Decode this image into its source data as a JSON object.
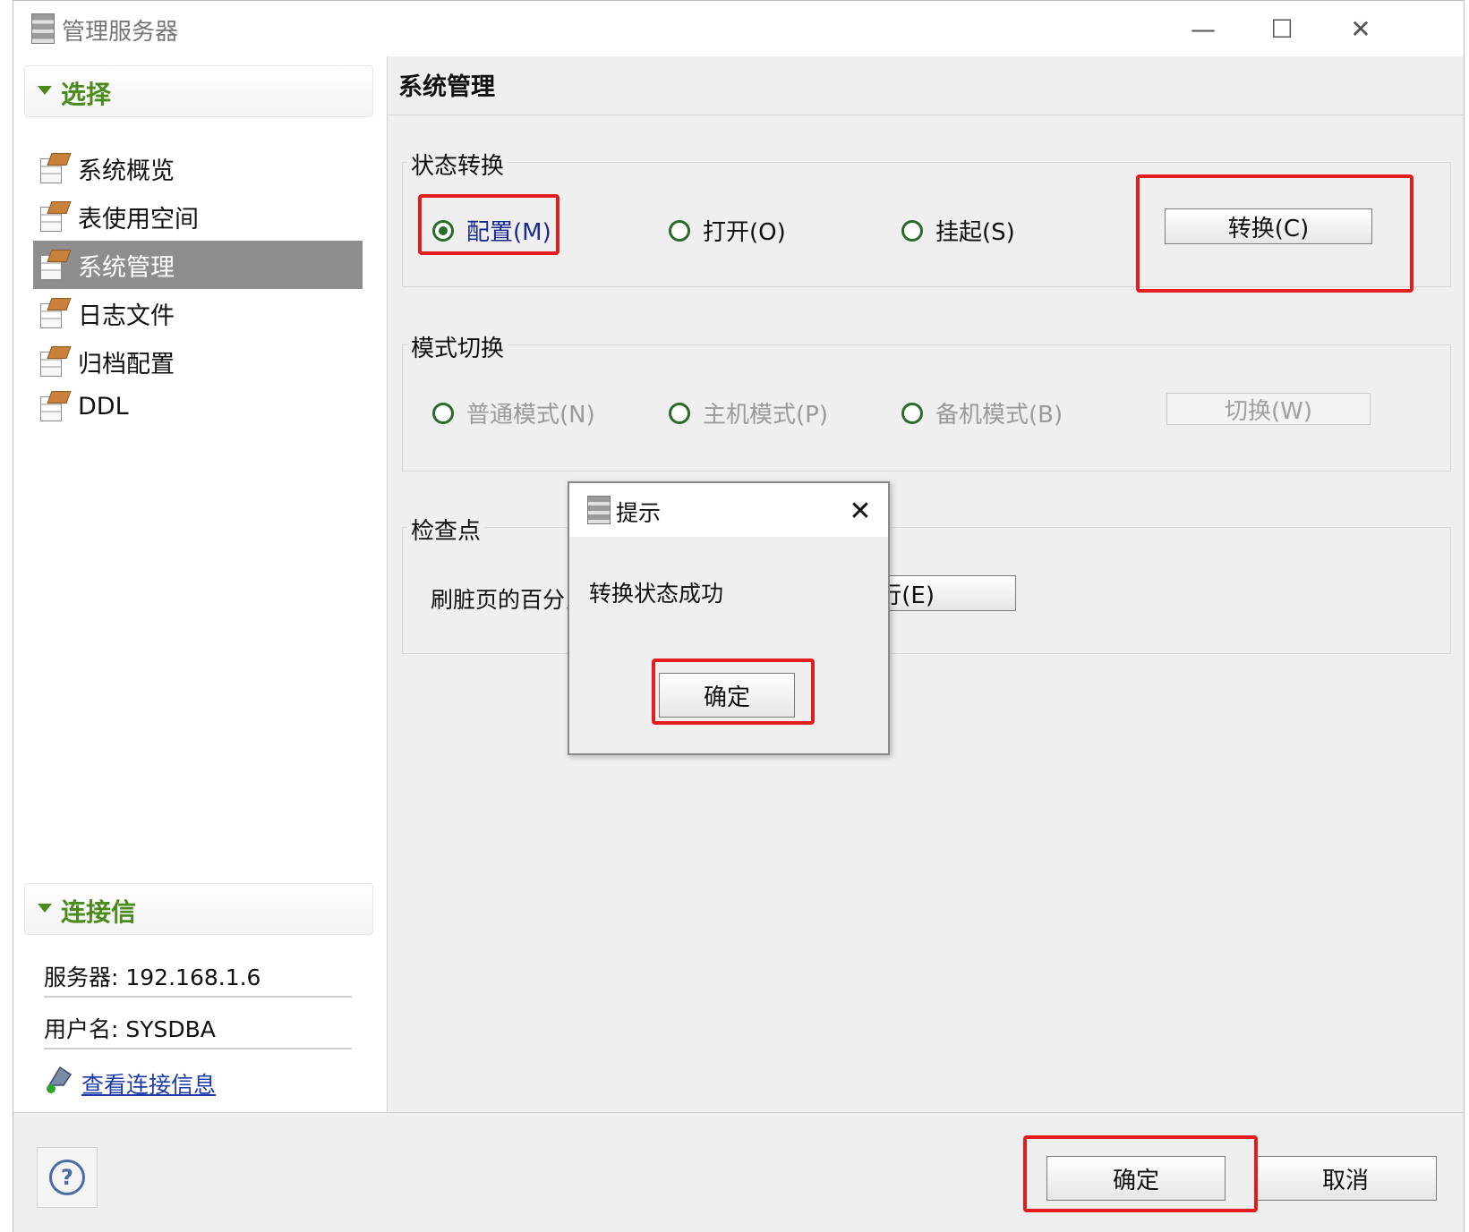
{
  "window": {
    "title": "管理服务器",
    "minimize_glyph": "—",
    "maximize_glyph": "☐",
    "close_glyph": "✕"
  },
  "left_panel": {
    "select_section": {
      "title": "选择",
      "items": [
        {
          "label": "系统概览",
          "icon": "page-icon",
          "selected": false
        },
        {
          "label": "表使用空间",
          "icon": "page-icon",
          "selected": false
        },
        {
          "label": "系统管理",
          "icon": "page-icon",
          "selected": true
        },
        {
          "label": "日志文件",
          "icon": "page-icon",
          "selected": false
        },
        {
          "label": "归档配置",
          "icon": "page-icon",
          "selected": false
        },
        {
          "label": "DDL",
          "icon": "page-icon",
          "selected": false
        }
      ]
    },
    "conn_section": {
      "title": "连接信",
      "server": "服务器: 192.168.1.6",
      "user": "用户名: SYSDBA",
      "link": "查看连接信息",
      "link_icon": "connection-icon"
    }
  },
  "right_panel": {
    "title": "系统管理",
    "state_group": {
      "title": "状态转换",
      "options": [
        {
          "label": "配置(M)",
          "checked": true,
          "enabled": true
        },
        {
          "label": "打开(O)",
          "checked": false,
          "enabled": true
        },
        {
          "label": "挂起(S)",
          "checked": false,
          "enabled": true
        }
      ],
      "button": "转换(C)"
    },
    "mode_group": {
      "title": "模式切换",
      "options": [
        {
          "label": "普通模式(N)",
          "checked": false,
          "enabled": false
        },
        {
          "label": "主机模式(P)",
          "checked": false,
          "enabled": false
        },
        {
          "label": "备机模式(B)",
          "checked": false,
          "enabled": false
        }
      ],
      "button": "切换(W)"
    },
    "checkpoint_group": {
      "title": "检查点",
      "label_visible": "刷脏页的百分比",
      "button_visible": "行(E)"
    }
  },
  "dialog": {
    "title": "提示",
    "message": "转换状态成功",
    "ok": "确定",
    "close_glyph": "✕"
  },
  "bottom": {
    "help_glyph": "?",
    "ok": "确定",
    "cancel": "取消"
  },
  "colors": {
    "highlight": "#e31d1d",
    "section_title": "#4b8a1c",
    "selected_nav": "#8e8e8e",
    "link": "#1a3aa8"
  }
}
